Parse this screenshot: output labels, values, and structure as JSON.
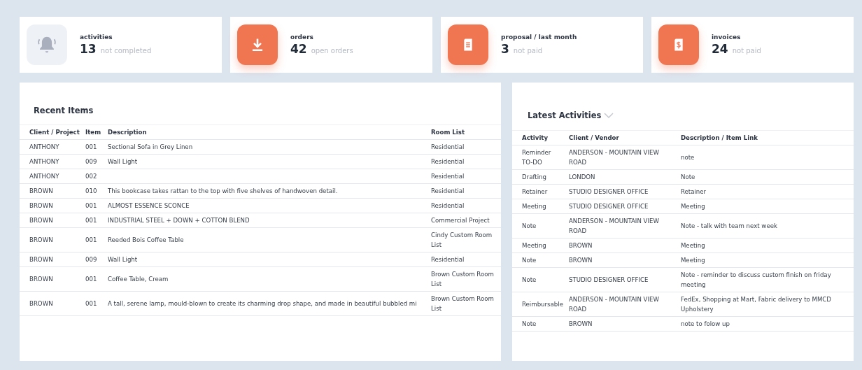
{
  "stats": [
    {
      "kind": "bell",
      "label": "activities",
      "count": "13",
      "note": "not completed"
    },
    {
      "kind": "download",
      "label": "orders",
      "count": "42",
      "note": "open orders"
    },
    {
      "kind": "document",
      "label": "**proposal** / last month",
      "count": "3",
      "note": "not paid"
    },
    {
      "kind": "invoice",
      "label": "invoices",
      "count": "24",
      "note": "not paid"
    }
  ],
  "recent_items": {
    "title": "Recent Items",
    "columns": [
      "Client / Project",
      "Item",
      "Description",
      "Room List"
    ],
    "rows": [
      {
        "client": "ANTHONY",
        "item": "001",
        "description": "Sectional Sofa in Grey Linen",
        "room_list": "Residential"
      },
      {
        "client": "ANTHONY",
        "item": "009",
        "description": "Wall Light",
        "room_list": "Residential"
      },
      {
        "client": "ANTHONY",
        "item": "002",
        "room_list": "Residential"
      },
      {
        "client": "BROWN",
        "item": "010",
        "description": "This bookcase takes rattan to the top with five shelves of handwoven detail.",
        "room_list": "Residential"
      },
      {
        "client": "BROWN",
        "item": "001",
        "description": "ALMOST ESSENCE SCONCE",
        "room_list": "Residential"
      },
      {
        "client": "BROWN",
        "item": "001",
        "description": "INDUSTRIAL STEEL + DOWN + COTTON BLEND",
        "room_list": "Commercial Project"
      },
      {
        "client": "BROWN",
        "item": "001",
        "description": "Reeded Bois Coffee Table",
        "room_list": "Cindy Custom Room List"
      },
      {
        "client": "BROWN",
        "item": "009",
        "description": "Wall Light",
        "room_list": "Residential"
      },
      {
        "client": "BROWN",
        "item": "001",
        "description": "Coffee Table, Cream",
        "room_list": "Brown Custom Room List"
      },
      {
        "client": "BROWN",
        "item": "001",
        "description": "A tall, serene lamp, mould-blown to create its charming drop shape, and made in beautiful bubbled mi",
        "room_list": "Brown Custom Room List"
      }
    ]
  },
  "latest_activities": {
    "title": "Latest Activities",
    "columns": [
      "Activity",
      "Client / Vendor",
      "Description / Item Link"
    ],
    "rows": [
      {
        "activity": "Reminder TO-DO",
        "client": "ANDERSON - MOUNTAIN VIEW ROAD",
        "description": "note"
      },
      {
        "activity": "Drafting",
        "client": "LONDON",
        "description": "Note"
      },
      {
        "activity": "Retainer",
        "client": "STUDIO DESIGNER OFFICE",
        "description": "Retainer"
      },
      {
        "activity": "Meeting",
        "client": "STUDIO DESIGNER OFFICE",
        "description": "Meeting"
      },
      {
        "activity": "Note",
        "client": "ANDERSON - MOUNTAIN VIEW ROAD",
        "description": "Note - talk with team next week"
      },
      {
        "activity": "Meeting",
        "client": "BROWN",
        "description": "Meeting"
      },
      {
        "activity": "Note",
        "client": "BROWN",
        "description": "Meeting"
      },
      {
        "activity": "Note",
        "client": "STUDIO DESIGNER OFFICE",
        "description": "Note - reminder to discuss custom finish on friday meeting"
      },
      {
        "activity": "Reimbursable",
        "client": "ANDERSON - MOUNTAIN VIEW ROAD",
        "description": "FedEx, Shopping at Mart, Fabric delivery to MMCD Upholstery"
      },
      {
        "activity": "Note",
        "client": "BROWN",
        "description": "note to folow up"
      }
    ]
  }
}
